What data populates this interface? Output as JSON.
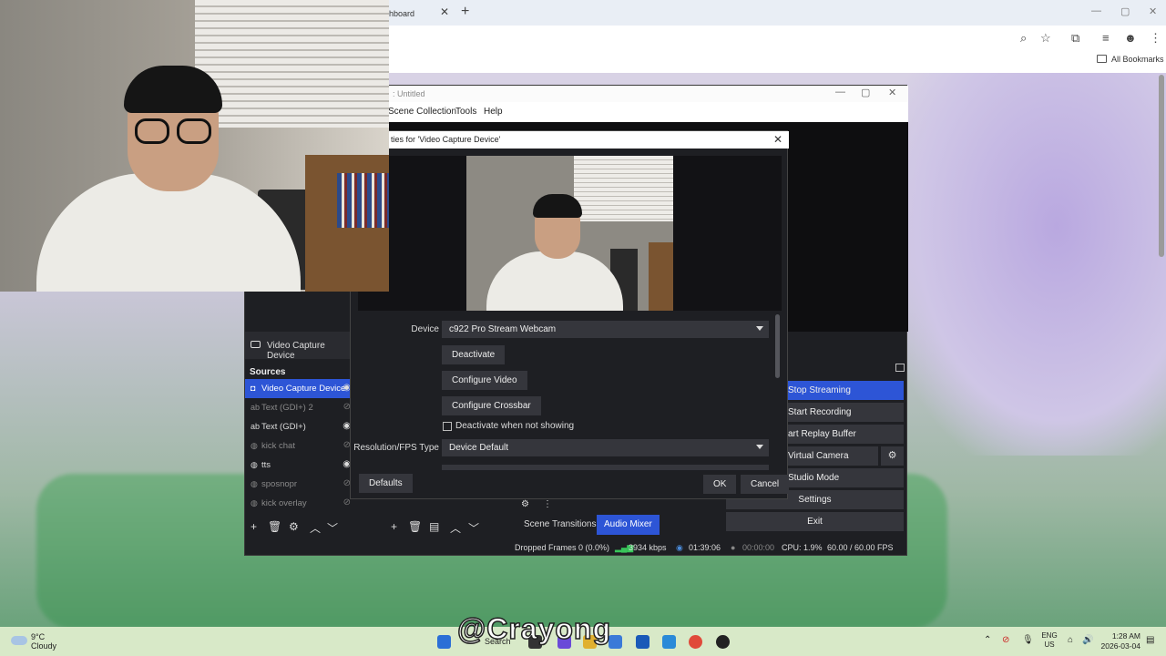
{
  "browser": {
    "tab_title": "hboard",
    "tab_close": "✕",
    "new_tab": "+",
    "bookmarks_label": "All Bookmarks"
  },
  "obs": {
    "window_title": ": Untitled",
    "menu": {
      "scene_collection": "Scene Collection",
      "tools": "Tools",
      "help": "Help"
    },
    "scene_item": "Video Capture Device",
    "sources_header": "Sources",
    "sources": [
      {
        "label": "Video Capture Device",
        "icon": "camera-icon",
        "glyph": "◘"
      },
      {
        "label": "Text (GDI+) 2",
        "icon": "text-icon",
        "glyph": "ab"
      },
      {
        "label": "Text (GDI+)",
        "icon": "text-icon",
        "glyph": "ab"
      },
      {
        "label": "kick chat",
        "icon": "browser-icon",
        "glyph": "◍"
      },
      {
        "label": "tts",
        "icon": "browser-icon",
        "glyph": "◍"
      },
      {
        "label": "sposnopr",
        "icon": "browser-icon",
        "glyph": "◍"
      },
      {
        "label": "kick overlay",
        "icon": "browser-icon",
        "glyph": "◍"
      }
    ],
    "tabs": {
      "scene_transitions": "Scene Transitions",
      "audio_mixer": "Audio Mixer"
    },
    "controls": {
      "stop_streaming": "Stop Streaming",
      "start_recording": "Start Recording",
      "replay_buffer": "art Replay Buffer",
      "virtual_camera": "Virtual Camera",
      "studio_mode": "Studio Mode",
      "settings": "Settings",
      "exit": "Exit"
    },
    "status": {
      "dropped_frames": "Dropped Frames 0 (0.0%)",
      "kbps": "3934 kbps",
      "stream_time": "01:39:06",
      "rec_time": "00:00:00",
      "cpu": "CPU: 1.9%",
      "fps": "60.00 / 60.00 FPS"
    }
  },
  "dialog": {
    "title": "ties for 'Video Capture Device'",
    "device_label": "Device",
    "device_value": "c922 Pro Stream Webcam",
    "deactivate": "Deactivate",
    "configure_video": "Configure Video",
    "configure_crossbar": "Configure Crossbar",
    "deactivate_when_not_showing": "Deactivate when not showing",
    "resolution_label": "Resolution/FPS Type",
    "resolution_value": "Device Default",
    "defaults": "Defaults",
    "ok": "OK",
    "cancel": "Cancel"
  },
  "watermark": "@Crayong",
  "taskbar": {
    "temp": "9°C",
    "weather": "Cloudy",
    "search": "Search",
    "lang_top": "ENG",
    "lang_bottom": "US",
    "time": "1:28 AM",
    "date": "2026-03-04"
  },
  "colors": {
    "obs_accent": "#2d55d6",
    "obs_bg": "#1e1f23",
    "obs_button": "#35363c",
    "stream_ok": "#38c55a"
  }
}
